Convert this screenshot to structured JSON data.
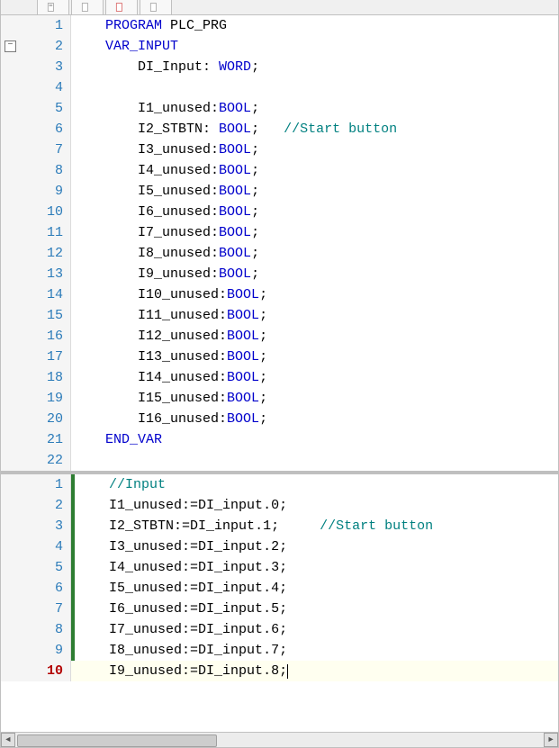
{
  "tabs": [
    {
      "label": ""
    },
    {
      "label": ""
    },
    {
      "label": ""
    },
    {
      "label": ""
    }
  ],
  "fold_glyph": "−",
  "top_pane": {
    "lines": [
      {
        "n": 1,
        "indent": "    ",
        "tokens": [
          {
            "t": "PROGRAM",
            "c": "kw"
          },
          {
            "t": " ",
            "c": "txt"
          },
          {
            "t": "PLC_PRG",
            "c": "txt"
          }
        ]
      },
      {
        "n": 2,
        "indent": "    ",
        "fold": true,
        "tokens": [
          {
            "t": "VAR_INPUT",
            "c": "kw"
          }
        ]
      },
      {
        "n": 3,
        "indent": "        ",
        "tokens": [
          {
            "t": "DI_Input",
            "c": "txt"
          },
          {
            "t": ": ",
            "c": "txt"
          },
          {
            "t": "WORD",
            "c": "type"
          },
          {
            "t": ";",
            "c": "txt"
          }
        ]
      },
      {
        "n": 4,
        "indent": "        ",
        "tokens": []
      },
      {
        "n": 5,
        "indent": "        ",
        "tokens": [
          {
            "t": "I1_unused",
            "c": "txt"
          },
          {
            "t": ":",
            "c": "txt"
          },
          {
            "t": "BOOL",
            "c": "type"
          },
          {
            "t": ";",
            "c": "txt"
          }
        ]
      },
      {
        "n": 6,
        "indent": "        ",
        "tokens": [
          {
            "t": "I2_STBTN",
            "c": "txt"
          },
          {
            "t": ": ",
            "c": "txt"
          },
          {
            "t": "BOOL",
            "c": "type"
          },
          {
            "t": ";",
            "c": "txt"
          },
          {
            "t": "   ",
            "c": "txt"
          },
          {
            "t": "//Start button",
            "c": "cmt"
          }
        ]
      },
      {
        "n": 7,
        "indent": "        ",
        "tokens": [
          {
            "t": "I3_unused",
            "c": "txt"
          },
          {
            "t": ":",
            "c": "txt"
          },
          {
            "t": "BOOL",
            "c": "type"
          },
          {
            "t": ";",
            "c": "txt"
          }
        ]
      },
      {
        "n": 8,
        "indent": "        ",
        "tokens": [
          {
            "t": "I4_unused",
            "c": "txt"
          },
          {
            "t": ":",
            "c": "txt"
          },
          {
            "t": "BOOL",
            "c": "type"
          },
          {
            "t": ";",
            "c": "txt"
          }
        ]
      },
      {
        "n": 9,
        "indent": "        ",
        "tokens": [
          {
            "t": "I5_unused",
            "c": "txt"
          },
          {
            "t": ":",
            "c": "txt"
          },
          {
            "t": "BOOL",
            "c": "type"
          },
          {
            "t": ";",
            "c": "txt"
          }
        ]
      },
      {
        "n": 10,
        "indent": "        ",
        "tokens": [
          {
            "t": "I6_unused",
            "c": "txt"
          },
          {
            "t": ":",
            "c": "txt"
          },
          {
            "t": "BOOL",
            "c": "type"
          },
          {
            "t": ";",
            "c": "txt"
          }
        ]
      },
      {
        "n": 11,
        "indent": "        ",
        "tokens": [
          {
            "t": "I7_unused",
            "c": "txt"
          },
          {
            "t": ":",
            "c": "txt"
          },
          {
            "t": "BOOL",
            "c": "type"
          },
          {
            "t": ";",
            "c": "txt"
          }
        ]
      },
      {
        "n": 12,
        "indent": "        ",
        "tokens": [
          {
            "t": "I8_unused",
            "c": "txt"
          },
          {
            "t": ":",
            "c": "txt"
          },
          {
            "t": "BOOL",
            "c": "type"
          },
          {
            "t": ";",
            "c": "txt"
          }
        ]
      },
      {
        "n": 13,
        "indent": "        ",
        "tokens": [
          {
            "t": "I9_unused",
            "c": "txt"
          },
          {
            "t": ":",
            "c": "txt"
          },
          {
            "t": "BOOL",
            "c": "type"
          },
          {
            "t": ";",
            "c": "txt"
          }
        ]
      },
      {
        "n": 14,
        "indent": "        ",
        "tokens": [
          {
            "t": "I10_unused",
            "c": "txt"
          },
          {
            "t": ":",
            "c": "txt"
          },
          {
            "t": "BOOL",
            "c": "type"
          },
          {
            "t": ";",
            "c": "txt"
          }
        ]
      },
      {
        "n": 15,
        "indent": "        ",
        "tokens": [
          {
            "t": "I11_unused",
            "c": "txt"
          },
          {
            "t": ":",
            "c": "txt"
          },
          {
            "t": "BOOL",
            "c": "type"
          },
          {
            "t": ";",
            "c": "txt"
          }
        ]
      },
      {
        "n": 16,
        "indent": "        ",
        "tokens": [
          {
            "t": "I12_unused",
            "c": "txt"
          },
          {
            "t": ":",
            "c": "txt"
          },
          {
            "t": "BOOL",
            "c": "type"
          },
          {
            "t": ";",
            "c": "txt"
          }
        ]
      },
      {
        "n": 17,
        "indent": "        ",
        "tokens": [
          {
            "t": "I13_unused",
            "c": "txt"
          },
          {
            "t": ":",
            "c": "txt"
          },
          {
            "t": "BOOL",
            "c": "type"
          },
          {
            "t": ";",
            "c": "txt"
          }
        ]
      },
      {
        "n": 18,
        "indent": "        ",
        "tokens": [
          {
            "t": "I14_unused",
            "c": "txt"
          },
          {
            "t": ":",
            "c": "txt"
          },
          {
            "t": "BOOL",
            "c": "type"
          },
          {
            "t": ";",
            "c": "txt"
          }
        ]
      },
      {
        "n": 19,
        "indent": "        ",
        "tokens": [
          {
            "t": "I15_unused",
            "c": "txt"
          },
          {
            "t": ":",
            "c": "txt"
          },
          {
            "t": "BOOL",
            "c": "type"
          },
          {
            "t": ";",
            "c": "txt"
          }
        ]
      },
      {
        "n": 20,
        "indent": "        ",
        "tokens": [
          {
            "t": "I16_unused",
            "c": "txt"
          },
          {
            "t": ":",
            "c": "txt"
          },
          {
            "t": "BOOL",
            "c": "type"
          },
          {
            "t": ";",
            "c": "txt"
          }
        ]
      },
      {
        "n": 21,
        "indent": "    ",
        "tokens": [
          {
            "t": "END_VAR",
            "c": "kw"
          }
        ]
      },
      {
        "n": 22,
        "indent": "",
        "tokens": []
      }
    ]
  },
  "bottom_pane": {
    "current_line": 10,
    "lines": [
      {
        "n": 1,
        "mark": "green",
        "indent": "    ",
        "tokens": [
          {
            "t": "//Input",
            "c": "cmt"
          }
        ]
      },
      {
        "n": 2,
        "mark": "green",
        "indent": "    ",
        "tokens": [
          {
            "t": "I1_unused",
            "c": "txt"
          },
          {
            "t": ":=",
            "c": "op"
          },
          {
            "t": "DI_input",
            "c": "txt"
          },
          {
            "t": ".",
            "c": "txt"
          },
          {
            "t": "0",
            "c": "txt"
          },
          {
            "t": ";",
            "c": "txt"
          }
        ]
      },
      {
        "n": 3,
        "mark": "green",
        "indent": "    ",
        "tokens": [
          {
            "t": "I2_STBTN",
            "c": "txt"
          },
          {
            "t": ":=",
            "c": "op"
          },
          {
            "t": "DI_input",
            "c": "txt"
          },
          {
            "t": ".",
            "c": "txt"
          },
          {
            "t": "1",
            "c": "txt"
          },
          {
            "t": ";",
            "c": "txt"
          },
          {
            "t": "     ",
            "c": "txt"
          },
          {
            "t": "//Start button",
            "c": "cmt"
          }
        ]
      },
      {
        "n": 4,
        "mark": "green",
        "indent": "    ",
        "tokens": [
          {
            "t": "I3_unused",
            "c": "txt"
          },
          {
            "t": ":=",
            "c": "op"
          },
          {
            "t": "DI_input",
            "c": "txt"
          },
          {
            "t": ".",
            "c": "txt"
          },
          {
            "t": "2",
            "c": "txt"
          },
          {
            "t": ";",
            "c": "txt"
          }
        ]
      },
      {
        "n": 5,
        "mark": "green",
        "indent": "    ",
        "tokens": [
          {
            "t": "I4_unused",
            "c": "txt"
          },
          {
            "t": ":=",
            "c": "op"
          },
          {
            "t": "DI_input",
            "c": "txt"
          },
          {
            "t": ".",
            "c": "txt"
          },
          {
            "t": "3",
            "c": "txt"
          },
          {
            "t": ";",
            "c": "txt"
          }
        ]
      },
      {
        "n": 6,
        "mark": "green",
        "indent": "    ",
        "tokens": [
          {
            "t": "I5_unused",
            "c": "txt"
          },
          {
            "t": ":=",
            "c": "op"
          },
          {
            "t": "DI_input",
            "c": "txt"
          },
          {
            "t": ".",
            "c": "txt"
          },
          {
            "t": "4",
            "c": "txt"
          },
          {
            "t": ";",
            "c": "txt"
          }
        ]
      },
      {
        "n": 7,
        "mark": "green",
        "indent": "    ",
        "tokens": [
          {
            "t": "I6_unused",
            "c": "txt"
          },
          {
            "t": ":=",
            "c": "op"
          },
          {
            "t": "DI_input",
            "c": "txt"
          },
          {
            "t": ".",
            "c": "txt"
          },
          {
            "t": "5",
            "c": "txt"
          },
          {
            "t": ";",
            "c": "txt"
          }
        ]
      },
      {
        "n": 8,
        "mark": "green",
        "indent": "    ",
        "tokens": [
          {
            "t": "I7_unused",
            "c": "txt"
          },
          {
            "t": ":=",
            "c": "op"
          },
          {
            "t": "DI_input",
            "c": "txt"
          },
          {
            "t": ".",
            "c": "txt"
          },
          {
            "t": "6",
            "c": "txt"
          },
          {
            "t": ";",
            "c": "txt"
          }
        ]
      },
      {
        "n": 9,
        "mark": "green",
        "indent": "    ",
        "tokens": [
          {
            "t": "I8_unused",
            "c": "txt"
          },
          {
            "t": ":=",
            "c": "op"
          },
          {
            "t": "DI_input",
            "c": "txt"
          },
          {
            "t": ".",
            "c": "txt"
          },
          {
            "t": "7",
            "c": "txt"
          },
          {
            "t": ";",
            "c": "txt"
          }
        ]
      },
      {
        "n": 10,
        "mark": "",
        "indent": "    ",
        "current": true,
        "caret": true,
        "tokens": [
          {
            "t": "I9_unused",
            "c": "txt"
          },
          {
            "t": ":=",
            "c": "op"
          },
          {
            "t": "DI_input",
            "c": "txt"
          },
          {
            "t": ".",
            "c": "txt"
          },
          {
            "t": "8",
            "c": "txt"
          },
          {
            "t": ";",
            "c": "txt"
          }
        ]
      }
    ]
  },
  "scroll": {
    "left_arrow": "◄",
    "right_arrow": "►"
  }
}
